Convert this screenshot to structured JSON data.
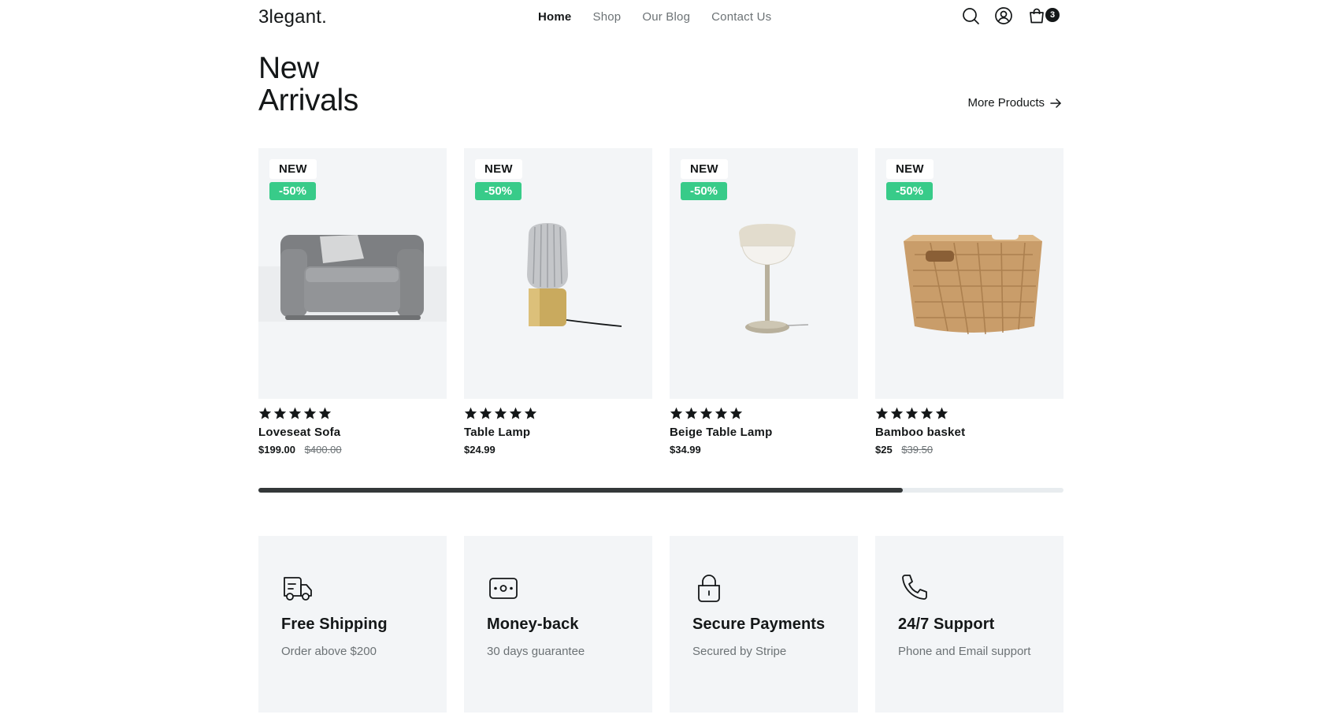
{
  "nav": {
    "logo": "3legant.",
    "links": [
      {
        "label": "Home",
        "active": true
      },
      {
        "label": "Shop",
        "active": false
      },
      {
        "label": "Our Blog",
        "active": false
      },
      {
        "label": "Contact Us",
        "active": false
      }
    ],
    "icons": [
      "search-icon",
      "user-icon",
      "cart-icon"
    ],
    "cart_count": "3"
  },
  "section": {
    "title_line1": "New",
    "title_line2": "Arrivals",
    "more_label": "More Products"
  },
  "products": [
    {
      "badge_new": "NEW",
      "badge_discount": "-50%",
      "rating": 5,
      "name": "Loveseat Sofa",
      "price": "$199.00",
      "old_price": "$400.00",
      "image": "sofa"
    },
    {
      "badge_new": "NEW",
      "badge_discount": "-50%",
      "rating": 5,
      "name": "Table Lamp",
      "price": "$24.99",
      "old_price": "",
      "image": "glass-lamp"
    },
    {
      "badge_new": "NEW",
      "badge_discount": "-50%",
      "rating": 5,
      "name": "Beige Table Lamp",
      "price": "$34.99",
      "old_price": "",
      "image": "beige-lamp"
    },
    {
      "badge_new": "NEW",
      "badge_discount": "-50%",
      "rating": 5,
      "name": "Bamboo basket",
      "price": "$25",
      "old_price": "$39.50",
      "image": "basket"
    }
  ],
  "carousel": {
    "progress": 0.8
  },
  "features": [
    {
      "icon": "truck-icon",
      "title": "Free Shipping",
      "desc": "Order above $200"
    },
    {
      "icon": "money-icon",
      "title": "Money-back",
      "desc": "30 days guarantee"
    },
    {
      "icon": "lock-icon",
      "title": "Secure Payments",
      "desc": "Secured by Stripe"
    },
    {
      "icon": "phone-icon",
      "title": "24/7 Support",
      "desc": "Phone and Email support"
    }
  ],
  "colors": {
    "accent_green": "#38cb89",
    "dark": "#141718",
    "muted": "#6c7275",
    "card_bg": "#f3f5f7"
  }
}
